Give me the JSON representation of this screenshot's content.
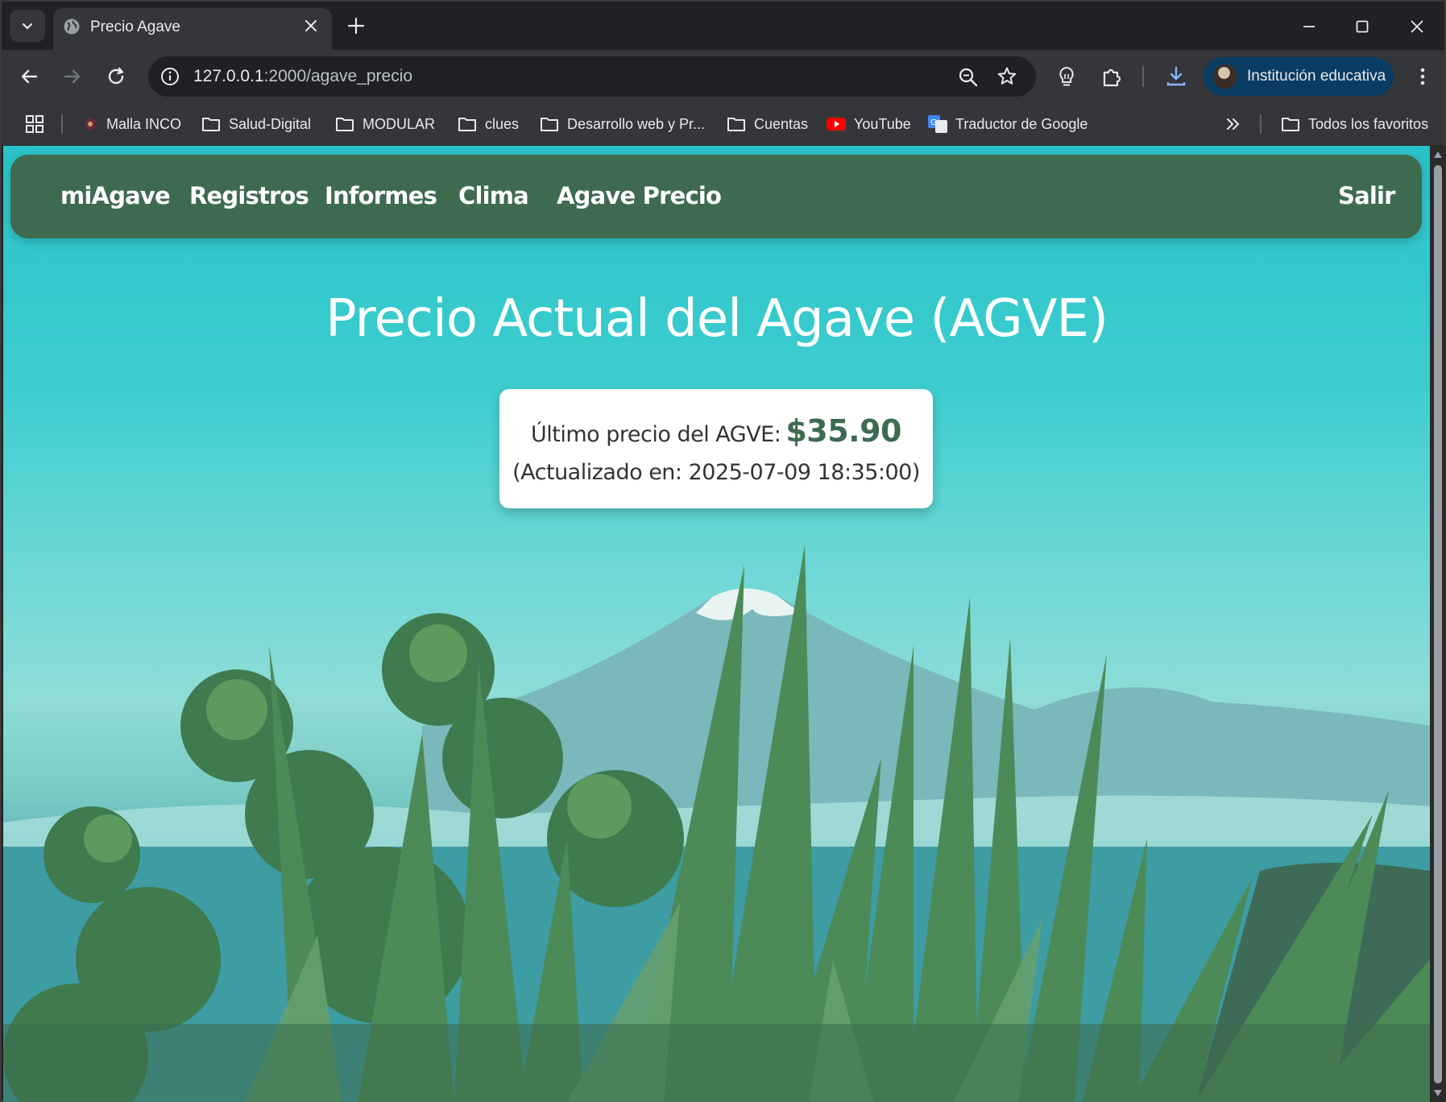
{
  "browser": {
    "tab_title": "Precio Agave",
    "url_host": "127.0.0.1",
    "url_rest": ":2000/agave_precio",
    "profile_label": "Institución educativa",
    "bookmarks": [
      {
        "label": "Malla INCO",
        "icon": "site-favicon"
      },
      {
        "label": "Salud-Digital",
        "icon": "folder-icon"
      },
      {
        "label": "MODULAR",
        "icon": "folder-icon"
      },
      {
        "label": "clues",
        "icon": "folder-icon"
      },
      {
        "label": "Desarrollo web y Pr...",
        "icon": "folder-icon"
      },
      {
        "label": "Cuentas",
        "icon": "folder-icon"
      },
      {
        "label": "YouTube",
        "icon": "youtube-icon"
      },
      {
        "label": "Traductor de Google",
        "icon": "google-translate-icon"
      }
    ],
    "all_bookmarks_label": "Todos los favoritos"
  },
  "nav": {
    "brand": "miAgave",
    "links": [
      "Registros",
      "Informes",
      "Clima",
      "Agave Precio"
    ],
    "logout": "Salir"
  },
  "page": {
    "title": "Precio Actual del Agave (AGVE)",
    "price_label": "Último precio del AGVE:",
    "price_value": "$35.90",
    "updated_text": "(Actualizado en: 2025-07-09 18:35:00)"
  },
  "colors": {
    "nav_bg": "#3e6b50",
    "price_accent": "#3e6b50",
    "sky": "#2fc4c9",
    "profile_chip": "#0b3c63"
  }
}
